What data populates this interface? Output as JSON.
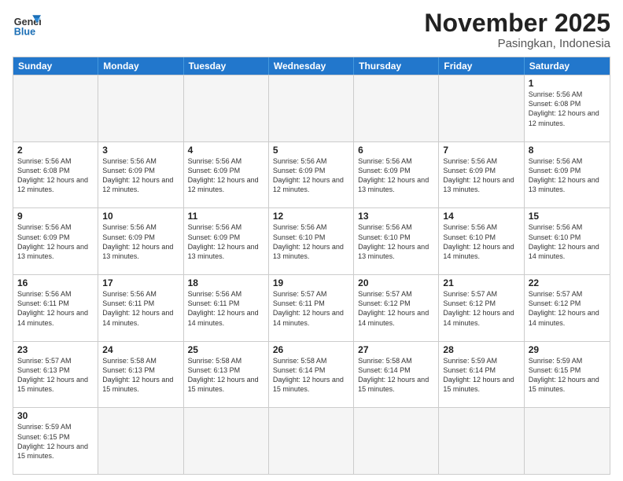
{
  "header": {
    "logo_general": "General",
    "logo_blue": "Blue",
    "month_title": "November 2025",
    "location": "Pasingkan, Indonesia"
  },
  "weekdays": [
    "Sunday",
    "Monday",
    "Tuesday",
    "Wednesday",
    "Thursday",
    "Friday",
    "Saturday"
  ],
  "rows": [
    [
      {
        "day": "",
        "info": "",
        "empty": true
      },
      {
        "day": "",
        "info": "",
        "empty": true
      },
      {
        "day": "",
        "info": "",
        "empty": true
      },
      {
        "day": "",
        "info": "",
        "empty": true
      },
      {
        "day": "",
        "info": "",
        "empty": true
      },
      {
        "day": "",
        "info": "",
        "empty": true
      },
      {
        "day": "1",
        "info": "Sunrise: 5:56 AM\nSunset: 6:08 PM\nDaylight: 12 hours and 12 minutes.",
        "empty": false
      }
    ],
    [
      {
        "day": "2",
        "info": "Sunrise: 5:56 AM\nSunset: 6:08 PM\nDaylight: 12 hours and 12 minutes.",
        "empty": false
      },
      {
        "day": "3",
        "info": "Sunrise: 5:56 AM\nSunset: 6:09 PM\nDaylight: 12 hours and 12 minutes.",
        "empty": false
      },
      {
        "day": "4",
        "info": "Sunrise: 5:56 AM\nSunset: 6:09 PM\nDaylight: 12 hours and 12 minutes.",
        "empty": false
      },
      {
        "day": "5",
        "info": "Sunrise: 5:56 AM\nSunset: 6:09 PM\nDaylight: 12 hours and 12 minutes.",
        "empty": false
      },
      {
        "day": "6",
        "info": "Sunrise: 5:56 AM\nSunset: 6:09 PM\nDaylight: 12 hours and 13 minutes.",
        "empty": false
      },
      {
        "day": "7",
        "info": "Sunrise: 5:56 AM\nSunset: 6:09 PM\nDaylight: 12 hours and 13 minutes.",
        "empty": false
      },
      {
        "day": "8",
        "info": "Sunrise: 5:56 AM\nSunset: 6:09 PM\nDaylight: 12 hours and 13 minutes.",
        "empty": false
      }
    ],
    [
      {
        "day": "9",
        "info": "Sunrise: 5:56 AM\nSunset: 6:09 PM\nDaylight: 12 hours and 13 minutes.",
        "empty": false
      },
      {
        "day": "10",
        "info": "Sunrise: 5:56 AM\nSunset: 6:09 PM\nDaylight: 12 hours and 13 minutes.",
        "empty": false
      },
      {
        "day": "11",
        "info": "Sunrise: 5:56 AM\nSunset: 6:09 PM\nDaylight: 12 hours and 13 minutes.",
        "empty": false
      },
      {
        "day": "12",
        "info": "Sunrise: 5:56 AM\nSunset: 6:10 PM\nDaylight: 12 hours and 13 minutes.",
        "empty": false
      },
      {
        "day": "13",
        "info": "Sunrise: 5:56 AM\nSunset: 6:10 PM\nDaylight: 12 hours and 13 minutes.",
        "empty": false
      },
      {
        "day": "14",
        "info": "Sunrise: 5:56 AM\nSunset: 6:10 PM\nDaylight: 12 hours and 14 minutes.",
        "empty": false
      },
      {
        "day": "15",
        "info": "Sunrise: 5:56 AM\nSunset: 6:10 PM\nDaylight: 12 hours and 14 minutes.",
        "empty": false
      }
    ],
    [
      {
        "day": "16",
        "info": "Sunrise: 5:56 AM\nSunset: 6:11 PM\nDaylight: 12 hours and 14 minutes.",
        "empty": false
      },
      {
        "day": "17",
        "info": "Sunrise: 5:56 AM\nSunset: 6:11 PM\nDaylight: 12 hours and 14 minutes.",
        "empty": false
      },
      {
        "day": "18",
        "info": "Sunrise: 5:56 AM\nSunset: 6:11 PM\nDaylight: 12 hours and 14 minutes.",
        "empty": false
      },
      {
        "day": "19",
        "info": "Sunrise: 5:57 AM\nSunset: 6:11 PM\nDaylight: 12 hours and 14 minutes.",
        "empty": false
      },
      {
        "day": "20",
        "info": "Sunrise: 5:57 AM\nSunset: 6:12 PM\nDaylight: 12 hours and 14 minutes.",
        "empty": false
      },
      {
        "day": "21",
        "info": "Sunrise: 5:57 AM\nSunset: 6:12 PM\nDaylight: 12 hours and 14 minutes.",
        "empty": false
      },
      {
        "day": "22",
        "info": "Sunrise: 5:57 AM\nSunset: 6:12 PM\nDaylight: 12 hours and 14 minutes.",
        "empty": false
      }
    ],
    [
      {
        "day": "23",
        "info": "Sunrise: 5:57 AM\nSunset: 6:13 PM\nDaylight: 12 hours and 15 minutes.",
        "empty": false
      },
      {
        "day": "24",
        "info": "Sunrise: 5:58 AM\nSunset: 6:13 PM\nDaylight: 12 hours and 15 minutes.",
        "empty": false
      },
      {
        "day": "25",
        "info": "Sunrise: 5:58 AM\nSunset: 6:13 PM\nDaylight: 12 hours and 15 minutes.",
        "empty": false
      },
      {
        "day": "26",
        "info": "Sunrise: 5:58 AM\nSunset: 6:14 PM\nDaylight: 12 hours and 15 minutes.",
        "empty": false
      },
      {
        "day": "27",
        "info": "Sunrise: 5:58 AM\nSunset: 6:14 PM\nDaylight: 12 hours and 15 minutes.",
        "empty": false
      },
      {
        "day": "28",
        "info": "Sunrise: 5:59 AM\nSunset: 6:14 PM\nDaylight: 12 hours and 15 minutes.",
        "empty": false
      },
      {
        "day": "29",
        "info": "Sunrise: 5:59 AM\nSunset: 6:15 PM\nDaylight: 12 hours and 15 minutes.",
        "empty": false
      }
    ],
    [
      {
        "day": "30",
        "info": "Sunrise: 5:59 AM\nSunset: 6:15 PM\nDaylight: 12 hours and 15 minutes.",
        "empty": false
      },
      {
        "day": "",
        "info": "",
        "empty": true
      },
      {
        "day": "",
        "info": "",
        "empty": true
      },
      {
        "day": "",
        "info": "",
        "empty": true
      },
      {
        "day": "",
        "info": "",
        "empty": true
      },
      {
        "day": "",
        "info": "",
        "empty": true
      },
      {
        "day": "",
        "info": "",
        "empty": true
      }
    ]
  ]
}
